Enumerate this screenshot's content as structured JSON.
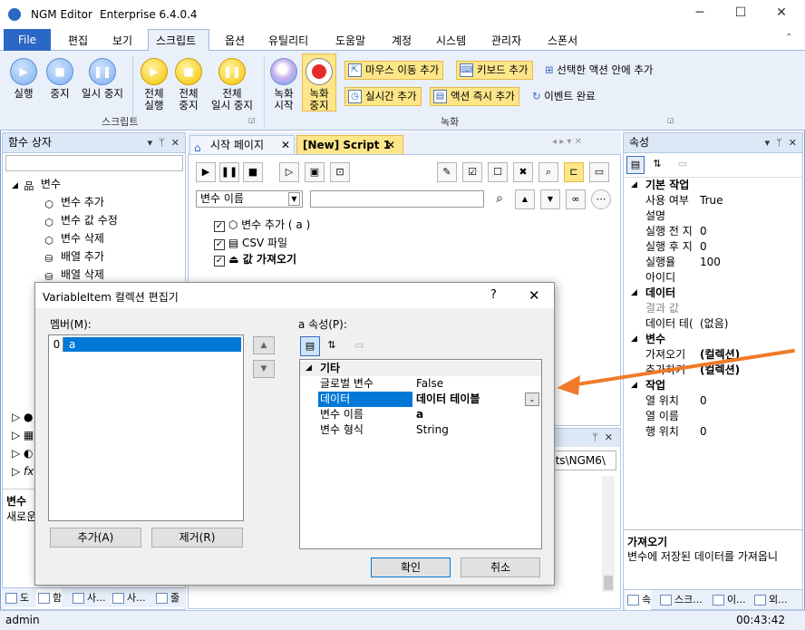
{
  "app": {
    "title": "NGM Editor",
    "edition": "Enterprise 6.4.0.4"
  },
  "menu": [
    "File",
    "편집",
    "보기",
    "스크립트",
    "옵션",
    "유틸리티",
    "도움말",
    "계정",
    "시스템",
    "관리자",
    "스폰서"
  ],
  "ribbon": {
    "run": "실행",
    "stop": "중지",
    "pause": "일시 중지",
    "all_run_1": "전체",
    "all_run_2": "실행",
    "all_stop_1": "전체",
    "all_stop_2": "중지",
    "all_pause_1": "전체",
    "all_pause_2": "일시 중지",
    "group_script": "스크립트",
    "rec_start_1": "녹화",
    "rec_start_2": "시작",
    "rec_stop_1": "녹화",
    "rec_stop_2": "중지",
    "mouse_move": "마우스 이동 추가",
    "key_add": "키보드 추가",
    "in_selected": "선택한 액션 안에 추가",
    "realtime": "실시간 추가",
    "action_now": "액션 즉시 추가",
    "event_done": "이벤트 완료",
    "group_record": "녹화"
  },
  "function_panel": {
    "title": "함수 상자",
    "items": [
      {
        "label": "변수",
        "icon": "tree-root-icon"
      },
      {
        "label": "변수 추가",
        "icon": "cube-icon"
      },
      {
        "label": "변수 값 수정",
        "icon": "cube-icon"
      },
      {
        "label": "변수 삭제",
        "icon": "cube-icon"
      },
      {
        "label": "배열 추가",
        "icon": "database-icon"
      },
      {
        "label": "배열 삭제",
        "icon": "database-icon"
      }
    ],
    "desc_title": "변수 ",
    "desc_text": "새로운"
  },
  "doc_tabs": {
    "start": "시작 페이지",
    "script": "[New] Script 1"
  },
  "search": {
    "field": "변수 이름"
  },
  "script_lines": [
    {
      "label": "변수 추가 ( a )",
      "bold": false
    },
    {
      "label": "CSV 파일",
      "bold": false
    },
    {
      "label": "값 가져오기",
      "bold": true
    }
  ],
  "output_path": "nts\\NGM6\\",
  "props": {
    "title": "속성",
    "cat_basic": "기본 작업",
    "use": {
      "k": "사용 여부",
      "v": "True"
    },
    "desc": {
      "k": "설명",
      "v": ""
    },
    "wait_before": {
      "k": "실행 전 지",
      "v": "0"
    },
    "wait_after": {
      "k": "실행 후 지",
      "v": "0"
    },
    "rate": {
      "k": "실행율",
      "v": "100"
    },
    "id": {
      "k": "아이디",
      "v": ""
    },
    "cat_data": "데이터",
    "result": {
      "k": "결과 값",
      "v": ""
    },
    "datatable": {
      "k": "데이터 테(",
      "v": "(없음)"
    },
    "cat_var": "변수",
    "get": {
      "k": "가져오기",
      "v": "(컬렉션)"
    },
    "add": {
      "k": "추가하기",
      "v": "(컬렉션)"
    },
    "cat_task": "작업",
    "col_pos": {
      "k": "열 위치",
      "v": "0"
    },
    "col_name": {
      "k": "열 이름",
      "v": ""
    },
    "row_pos": {
      "k": "행 위치",
      "v": "0"
    },
    "help_title": "가져오기",
    "help_text": "변수에 저장된 데이터를 가져옵니"
  },
  "dialog": {
    "title": "VariableItem 컬렉션 편집기",
    "help": "?",
    "members_label": "멤버(M):",
    "member_index": "0",
    "member_value": "a",
    "props_label": "a 속성(P):",
    "cat": "기타",
    "rows": [
      {
        "k": "글로벌 변수",
        "v": "False"
      },
      {
        "k": "데이터",
        "v": "데이터 테이블"
      },
      {
        "k": "변수 이름",
        "v": "a"
      },
      {
        "k": "변수 형식",
        "v": "String"
      }
    ],
    "add_btn": "추가(A)",
    "remove_btn": "제거(R)",
    "ok_btn": "확인",
    "cancel_btn": "취소"
  },
  "bottom_tabs_left": [
    "도",
    "함",
    "사...",
    "사...",
    "줄"
  ],
  "bottom_tabs_right": [
    "속",
    "스크...",
    "이...",
    "외..."
  ],
  "status": {
    "user": "admin",
    "time": "00:43:42"
  },
  "colors": {
    "accent": "#2b67c4",
    "arrow": "#f07a28",
    "selection": "#0078d7",
    "ribbon_bg": "#e9f0fa"
  }
}
